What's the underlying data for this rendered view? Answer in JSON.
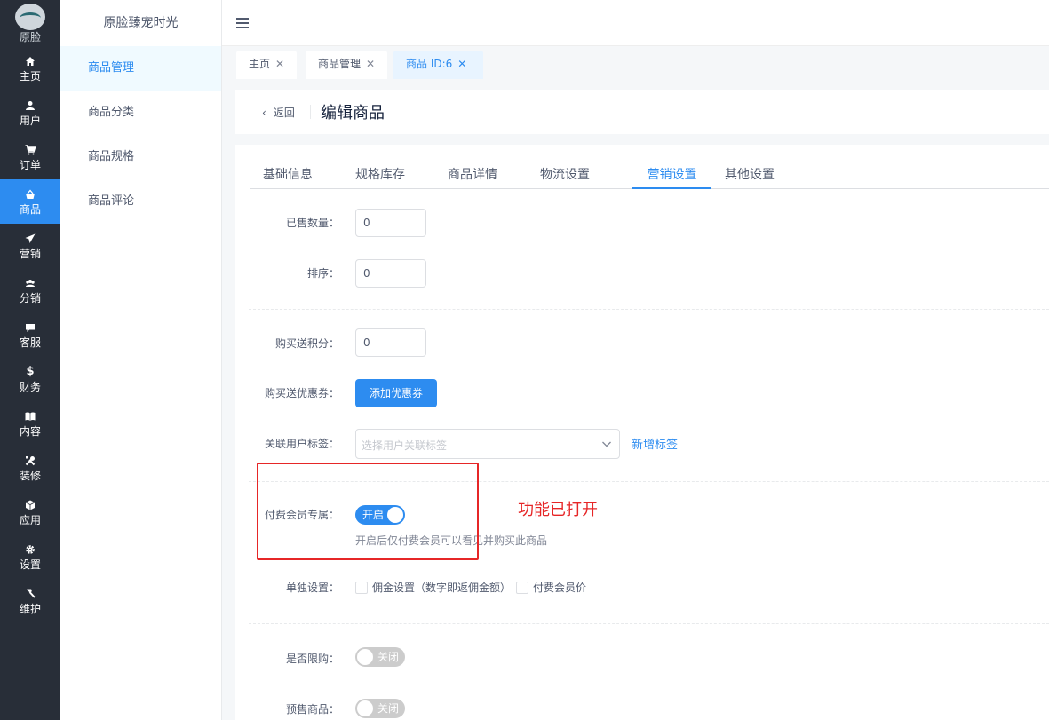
{
  "rail": {
    "brand": "原脸",
    "items": [
      {
        "label": "主页",
        "icon": "home-icon"
      },
      {
        "label": "用户",
        "icon": "user-icon"
      },
      {
        "label": "订单",
        "icon": "cart-icon"
      },
      {
        "label": "商品",
        "icon": "basket-icon"
      },
      {
        "label": "营销",
        "icon": "paper-plane-icon"
      },
      {
        "label": "分销",
        "icon": "group-icon"
      },
      {
        "label": "客服",
        "icon": "chat-icon"
      },
      {
        "label": "财务",
        "icon": "dollar-icon"
      },
      {
        "label": "内容",
        "icon": "book-icon"
      },
      {
        "label": "装修",
        "icon": "tools-icon"
      },
      {
        "label": "应用",
        "icon": "cube-icon"
      },
      {
        "label": "设置",
        "icon": "gear-icon"
      },
      {
        "label": "维护",
        "icon": "hammer-icon"
      }
    ],
    "active_index": 3
  },
  "menu": {
    "title": "原脸臻宠时光",
    "items": [
      "商品管理",
      "商品分类",
      "商品规格",
      "商品评论"
    ],
    "active_index": 0
  },
  "tabs": [
    {
      "label": "主页"
    },
    {
      "label": "商品管理"
    },
    {
      "label": "商品 ID:6"
    }
  ],
  "page": {
    "back_label": "返回",
    "title": "编辑商品"
  },
  "form_tabs": [
    "基础信息",
    "规格库存",
    "商品详情",
    "物流设置",
    "营销设置",
    "其他设置"
  ],
  "form_tabs_active": 4,
  "form": {
    "sold_count": {
      "label": "已售数量：",
      "value": "0"
    },
    "sort": {
      "label": "排序：",
      "value": "0"
    },
    "points": {
      "label": "购买送积分：",
      "value": "0"
    },
    "coupon": {
      "label": "购买送优惠券：",
      "button": "添加优惠券"
    },
    "user_tags": {
      "label": "关联用户标签：",
      "placeholder": "选择用户关联标签",
      "add_link": "新增标签"
    },
    "vip_only": {
      "label": "付费会员专属：",
      "switch_text": "开启",
      "on": true,
      "hint": "开启后仅付费会员可以看见并购买此商品"
    },
    "individual": {
      "label": "单独设置：",
      "options": [
        "佣金设置（数字即返佣金额）",
        "付费会员价"
      ]
    },
    "limit": {
      "label": "是否限购：",
      "switch_text": "关闭",
      "on": false
    },
    "presale": {
      "label": "预售商品：",
      "switch_text": "关闭",
      "on": false
    }
  },
  "annotation": "功能已打开",
  "colors": {
    "accent": "#2d8cf0",
    "annotation": "#e62627",
    "rail_bg": "#282e38"
  }
}
